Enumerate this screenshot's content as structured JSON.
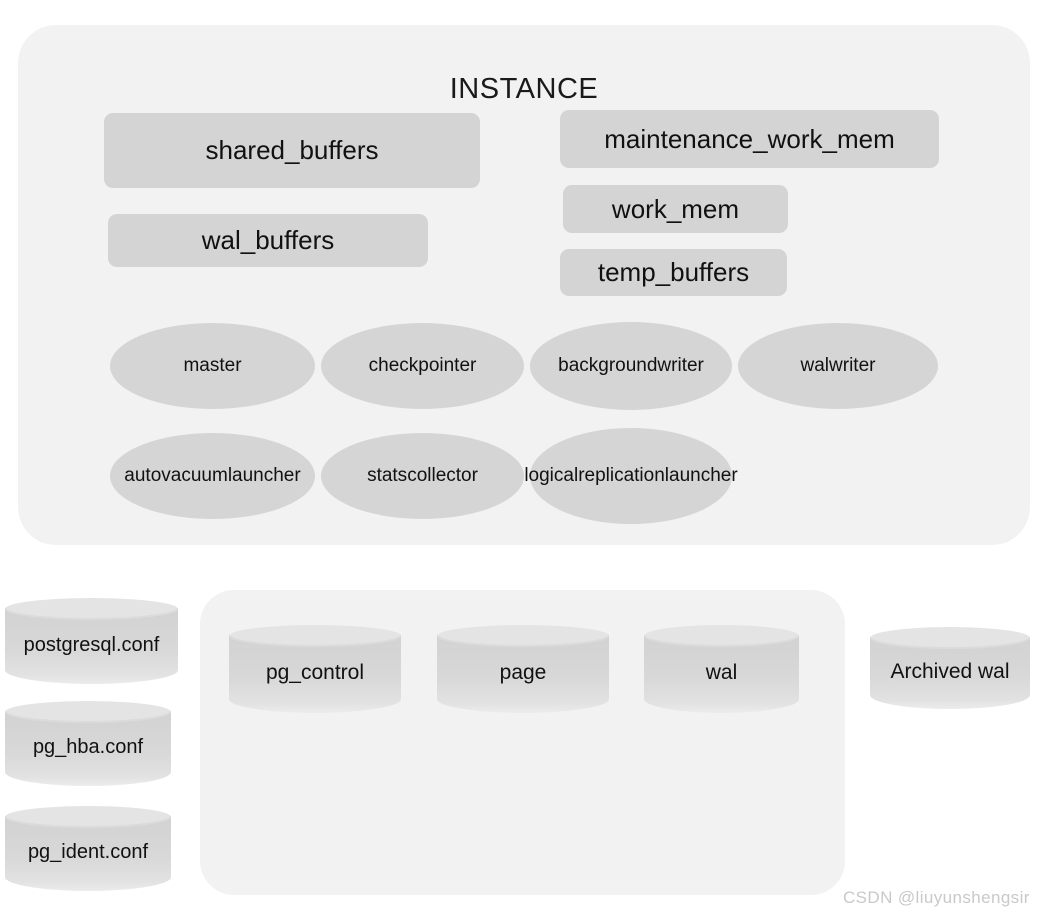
{
  "instance": {
    "title": "INSTANCE",
    "memory_boxes": [
      {
        "id": "shared-buffers",
        "label": "shared_buffers"
      },
      {
        "id": "wal-buffers",
        "label": "wal_buffers"
      },
      {
        "id": "maintenance-work-mem",
        "label": "maintenance_work_mem"
      },
      {
        "id": "work-mem",
        "label": "work_mem"
      },
      {
        "id": "temp-buffers",
        "label": "temp_buffers"
      }
    ],
    "processes": [
      {
        "id": "master",
        "label": "master"
      },
      {
        "id": "checkpointer",
        "label": "checkpointer"
      },
      {
        "id": "background-writer",
        "label": "background\nwriter"
      },
      {
        "id": "walwriter",
        "label": "walwriter"
      },
      {
        "id": "autovacuum-launcher",
        "label": "autovacuum\nlauncher"
      },
      {
        "id": "stats-collector",
        "label": "stats\ncollector"
      },
      {
        "id": "logical-replication-launcher",
        "label": "logical\nreplication\nlauncher"
      }
    ]
  },
  "config_files": [
    {
      "id": "postgresql-conf",
      "label": "postgresql.conf"
    },
    {
      "id": "pg-hba-conf",
      "label": "pg_hba.conf"
    },
    {
      "id": "pg-ident-conf",
      "label": "pg_ident.conf"
    }
  ],
  "storage": {
    "items": [
      {
        "id": "pg-control",
        "label": "pg_control"
      },
      {
        "id": "page",
        "label": "page"
      },
      {
        "id": "wal",
        "label": "wal"
      }
    ]
  },
  "archive": {
    "id": "archived-wal",
    "label": "Archived wal"
  },
  "watermark": "CSDN @liuyunshengsir",
  "colors": {
    "panel_background": "#f2f2f2",
    "box_fill": "#d4d4d4",
    "ellipse_fill": "#d5d5d5",
    "cylinder_top": "#e4e4e4",
    "cylinder_body": "#d8d8d8",
    "text": "#111111",
    "watermark": "#c9c9c9",
    "page_background": "#ffffff"
  }
}
